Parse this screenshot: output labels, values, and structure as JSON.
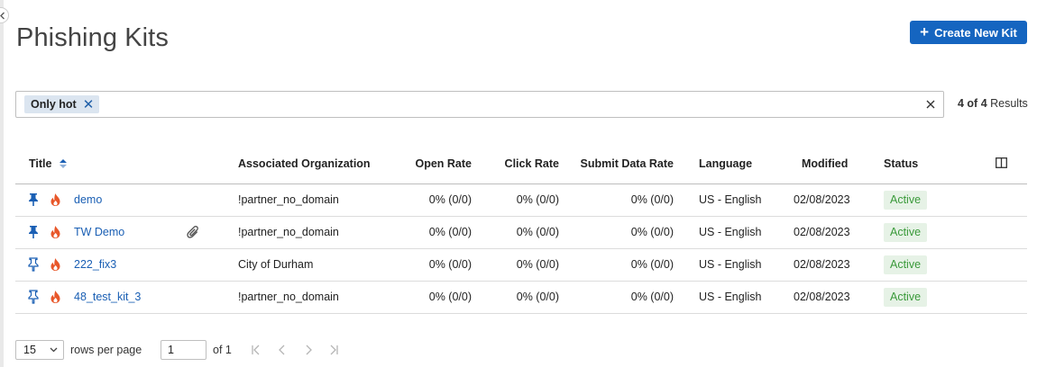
{
  "page": {
    "title": "Phishing Kits"
  },
  "toolbar": {
    "create_label": "Create New Kit"
  },
  "filter": {
    "chip_label": "Only hot",
    "results_current": "4 of 4",
    "results_suffix": " Results"
  },
  "table": {
    "columns": {
      "title": "Title",
      "organization": "Associated Organization",
      "open_rate": "Open Rate",
      "click_rate": "Click Rate",
      "submit_rate": "Submit Data Rate",
      "language": "Language",
      "modified": "Modified",
      "status": "Status"
    },
    "rows": [
      {
        "title": "demo",
        "pinned": true,
        "hot": true,
        "attachment": false,
        "organization": "!partner_no_domain",
        "open_rate": "0% (0/0)",
        "click_rate": "0% (0/0)",
        "submit_rate": "0% (0/0)",
        "language": "US - English",
        "modified": "02/08/2023",
        "status": "Active"
      },
      {
        "title": "TW Demo",
        "pinned": true,
        "hot": true,
        "attachment": true,
        "organization": "!partner_no_domain",
        "open_rate": "0% (0/0)",
        "click_rate": "0% (0/0)",
        "submit_rate": "0% (0/0)",
        "language": "US - English",
        "modified": "02/08/2023",
        "status": "Active"
      },
      {
        "title": "222_fix3",
        "pinned": false,
        "hot": true,
        "attachment": false,
        "organization": "City of Durham",
        "open_rate": "0% (0/0)",
        "click_rate": "0% (0/0)",
        "submit_rate": "0% (0/0)",
        "language": "US - English",
        "modified": "02/08/2023",
        "status": "Active"
      },
      {
        "title": "48_test_kit_3",
        "pinned": false,
        "hot": true,
        "attachment": false,
        "organization": "!partner_no_domain",
        "open_rate": "0% (0/0)",
        "click_rate": "0% (0/0)",
        "submit_rate": "0% (0/0)",
        "language": "US - English",
        "modified": "02/08/2023",
        "status": "Active"
      }
    ]
  },
  "pagination": {
    "rows_per_page": "15",
    "rows_per_page_label": "rows per page",
    "page_value": "1",
    "of_label": "of 1"
  },
  "colors": {
    "accent": "#1565c0",
    "link": "#1a5fb4",
    "hot": "#e8572a",
    "status_bg": "#e6f2e6",
    "status_text": "#3a9a3a"
  },
  "icons": {
    "collapse": "chevron-left-icon",
    "create": "plus-icon",
    "chip_remove": "close-icon",
    "clear": "close-icon",
    "sort": "sort-icon",
    "columns": "columns-icon",
    "pin": "pin-icon",
    "hot": "flame-icon",
    "attachment": "paperclip-icon",
    "first": "first-page-icon",
    "prev": "prev-page-icon",
    "next": "next-page-icon",
    "last": "last-page-icon"
  }
}
